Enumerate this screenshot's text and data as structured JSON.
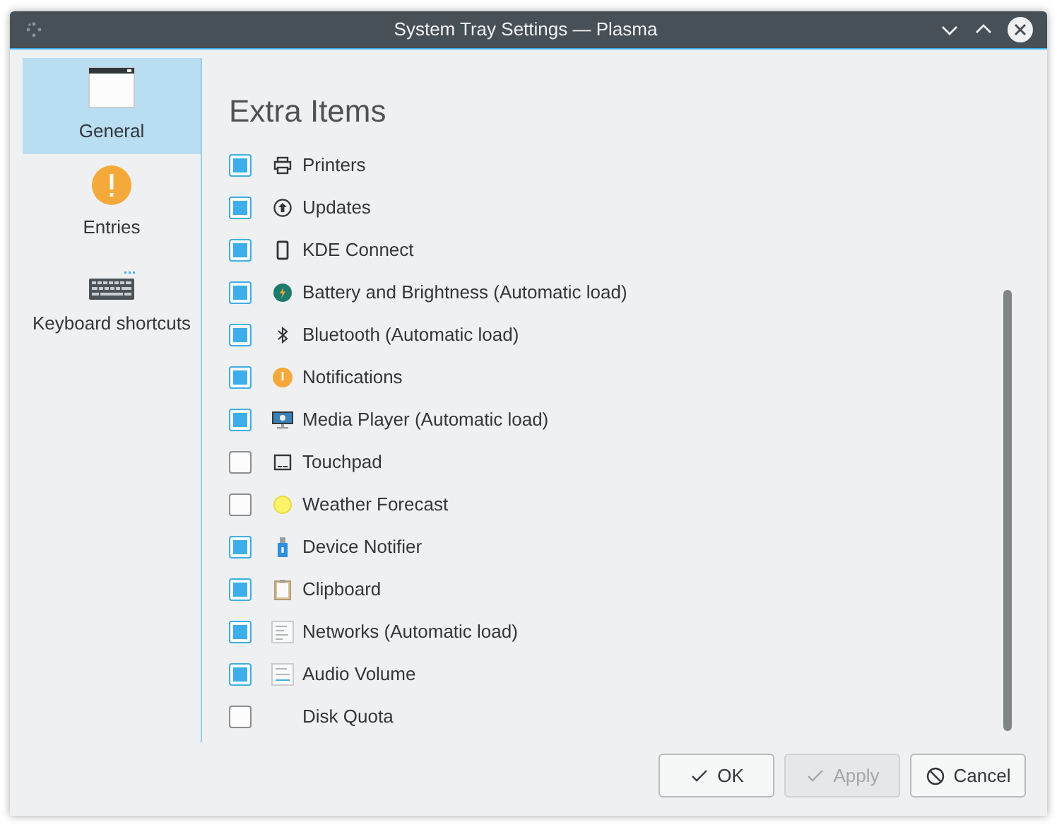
{
  "window": {
    "title": "System Tray Settings — Plasma"
  },
  "sidebar": {
    "items": [
      {
        "label": "General",
        "selected": true
      },
      {
        "label": "Entries",
        "selected": false
      },
      {
        "label": "Keyboard shortcuts",
        "selected": false
      }
    ]
  },
  "heading": "Extra Items",
  "items": [
    {
      "label": "Printers",
      "checked": true
    },
    {
      "label": "Updates",
      "checked": true
    },
    {
      "label": "KDE Connect",
      "checked": true
    },
    {
      "label": "Battery and Brightness (Automatic load)",
      "checked": true
    },
    {
      "label": "Bluetooth (Automatic load)",
      "checked": true
    },
    {
      "label": "Notifications",
      "checked": true
    },
    {
      "label": "Media Player (Automatic load)",
      "checked": true
    },
    {
      "label": "Touchpad",
      "checked": false
    },
    {
      "label": "Weather Forecast",
      "checked": false
    },
    {
      "label": "Device Notifier",
      "checked": true
    },
    {
      "label": "Clipboard",
      "checked": true
    },
    {
      "label": "Networks (Automatic load)",
      "checked": true
    },
    {
      "label": "Audio Volume",
      "checked": true
    },
    {
      "label": "Disk Quota",
      "checked": false
    }
  ],
  "buttons": [
    {
      "label": "OK",
      "disabled": false
    },
    {
      "label": "Apply",
      "disabled": true
    },
    {
      "label": "Cancel",
      "disabled": false
    }
  ]
}
